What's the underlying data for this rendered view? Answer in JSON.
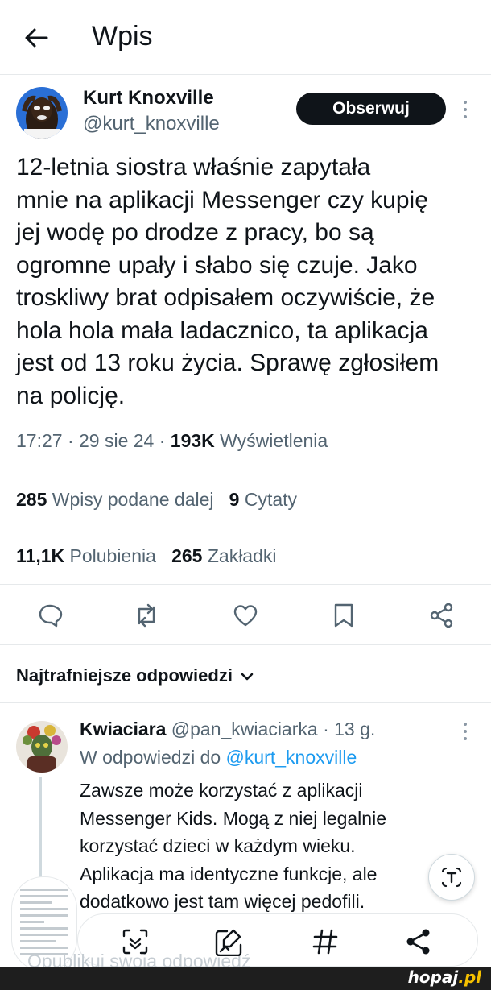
{
  "header": {
    "title": "Wpis"
  },
  "author": {
    "name": "Kurt Knoxville",
    "handle": "@kurt_knoxville",
    "follow_label": "Obserwuj"
  },
  "tweet": {
    "text": "12-letnia siostra właśnie zapytała\nmnie na aplikacji Messenger czy kupię\njej wodę po drodze z pracy, bo są\nogromne upały i słabo się czuje. Jako\ntroskliwy brat odpisałem oczywiście, że\nhola hola mała ladacznico, ta aplikacja\njest od 13 roku życia. Sprawę zgłosiłem\nna policję.",
    "time": "17:27 · 29 sie 24 · ",
    "views_count": "193K",
    "views_label": "Wyświetlenia"
  },
  "stats": {
    "reposts_count": "285",
    "reposts_label": "Wpisy podane dalej",
    "quotes_count": "9",
    "quotes_label": "Cytaty",
    "likes_count": "11,1K",
    "likes_label": "Polubienia",
    "bookmarks_count": "265",
    "bookmarks_label": "Zakładki"
  },
  "actions": [
    "reply-icon",
    "repost-icon",
    "like-icon",
    "bookmark-icon",
    "share-icon"
  ],
  "replies_section": {
    "title": "Najtrafniejsze odpowiedzi"
  },
  "reply": {
    "name": "Kwiaciara",
    "handle": "@pan_kwiaciarka",
    "time": " · 13 g.",
    "reply_to_prefix": "W odpowiedzi do ",
    "reply_to_handle": "@kurt_knoxville",
    "text": "Zawsze może korzystać z aplikacji\nMessenger Kids. Mogą z niej legalnie\nkorzystać dzieci w każdym wieku.\nAplikacja ma identyczne funkcje, ale\ndodatkowo jest tam więcej pedofili."
  },
  "composer": {
    "placeholder": "Opublikuj swoją odpowiedź",
    "tools": [
      "ai-sparkle-icon",
      "compose-image-icon",
      "hashtag-icon",
      "share-icon"
    ]
  },
  "footer": {
    "logo_main": "hopaj",
    "logo_tld": ".pl"
  },
  "colors": {
    "accent": "#1d9bf0",
    "text": "#0f1419",
    "muted": "#536471",
    "follow_bg": "#0f1419"
  }
}
